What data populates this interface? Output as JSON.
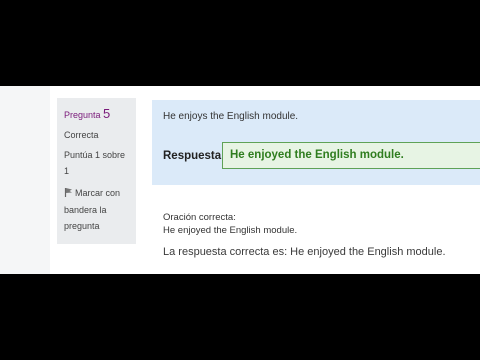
{
  "question_info": {
    "label": "Pregunta",
    "number": "5",
    "state": "Correcta",
    "grade_line1": "Puntúa 1 sobre",
    "grade_line2": "1",
    "flag_line1": "Marcar con",
    "flag_line2": "bandera la",
    "flag_line3": "pregunta"
  },
  "question": {
    "text": "He enjoys the English module.",
    "answer_label": "Respuesta:",
    "answer_value": "He enjoyed the English module."
  },
  "feedback": {
    "correct_label": "Oración correcta:",
    "correct_sentence": "He enjoyed the English module.",
    "right_answer": "La respuesta correcta es: He enjoyed the English module."
  },
  "colors": {
    "info_bg": "#eaecee",
    "question_bg": "#dbeaf9",
    "correct_border": "#5fa257",
    "correct_text": "#2f7d1f",
    "title_purple": "#7a1a7a"
  }
}
